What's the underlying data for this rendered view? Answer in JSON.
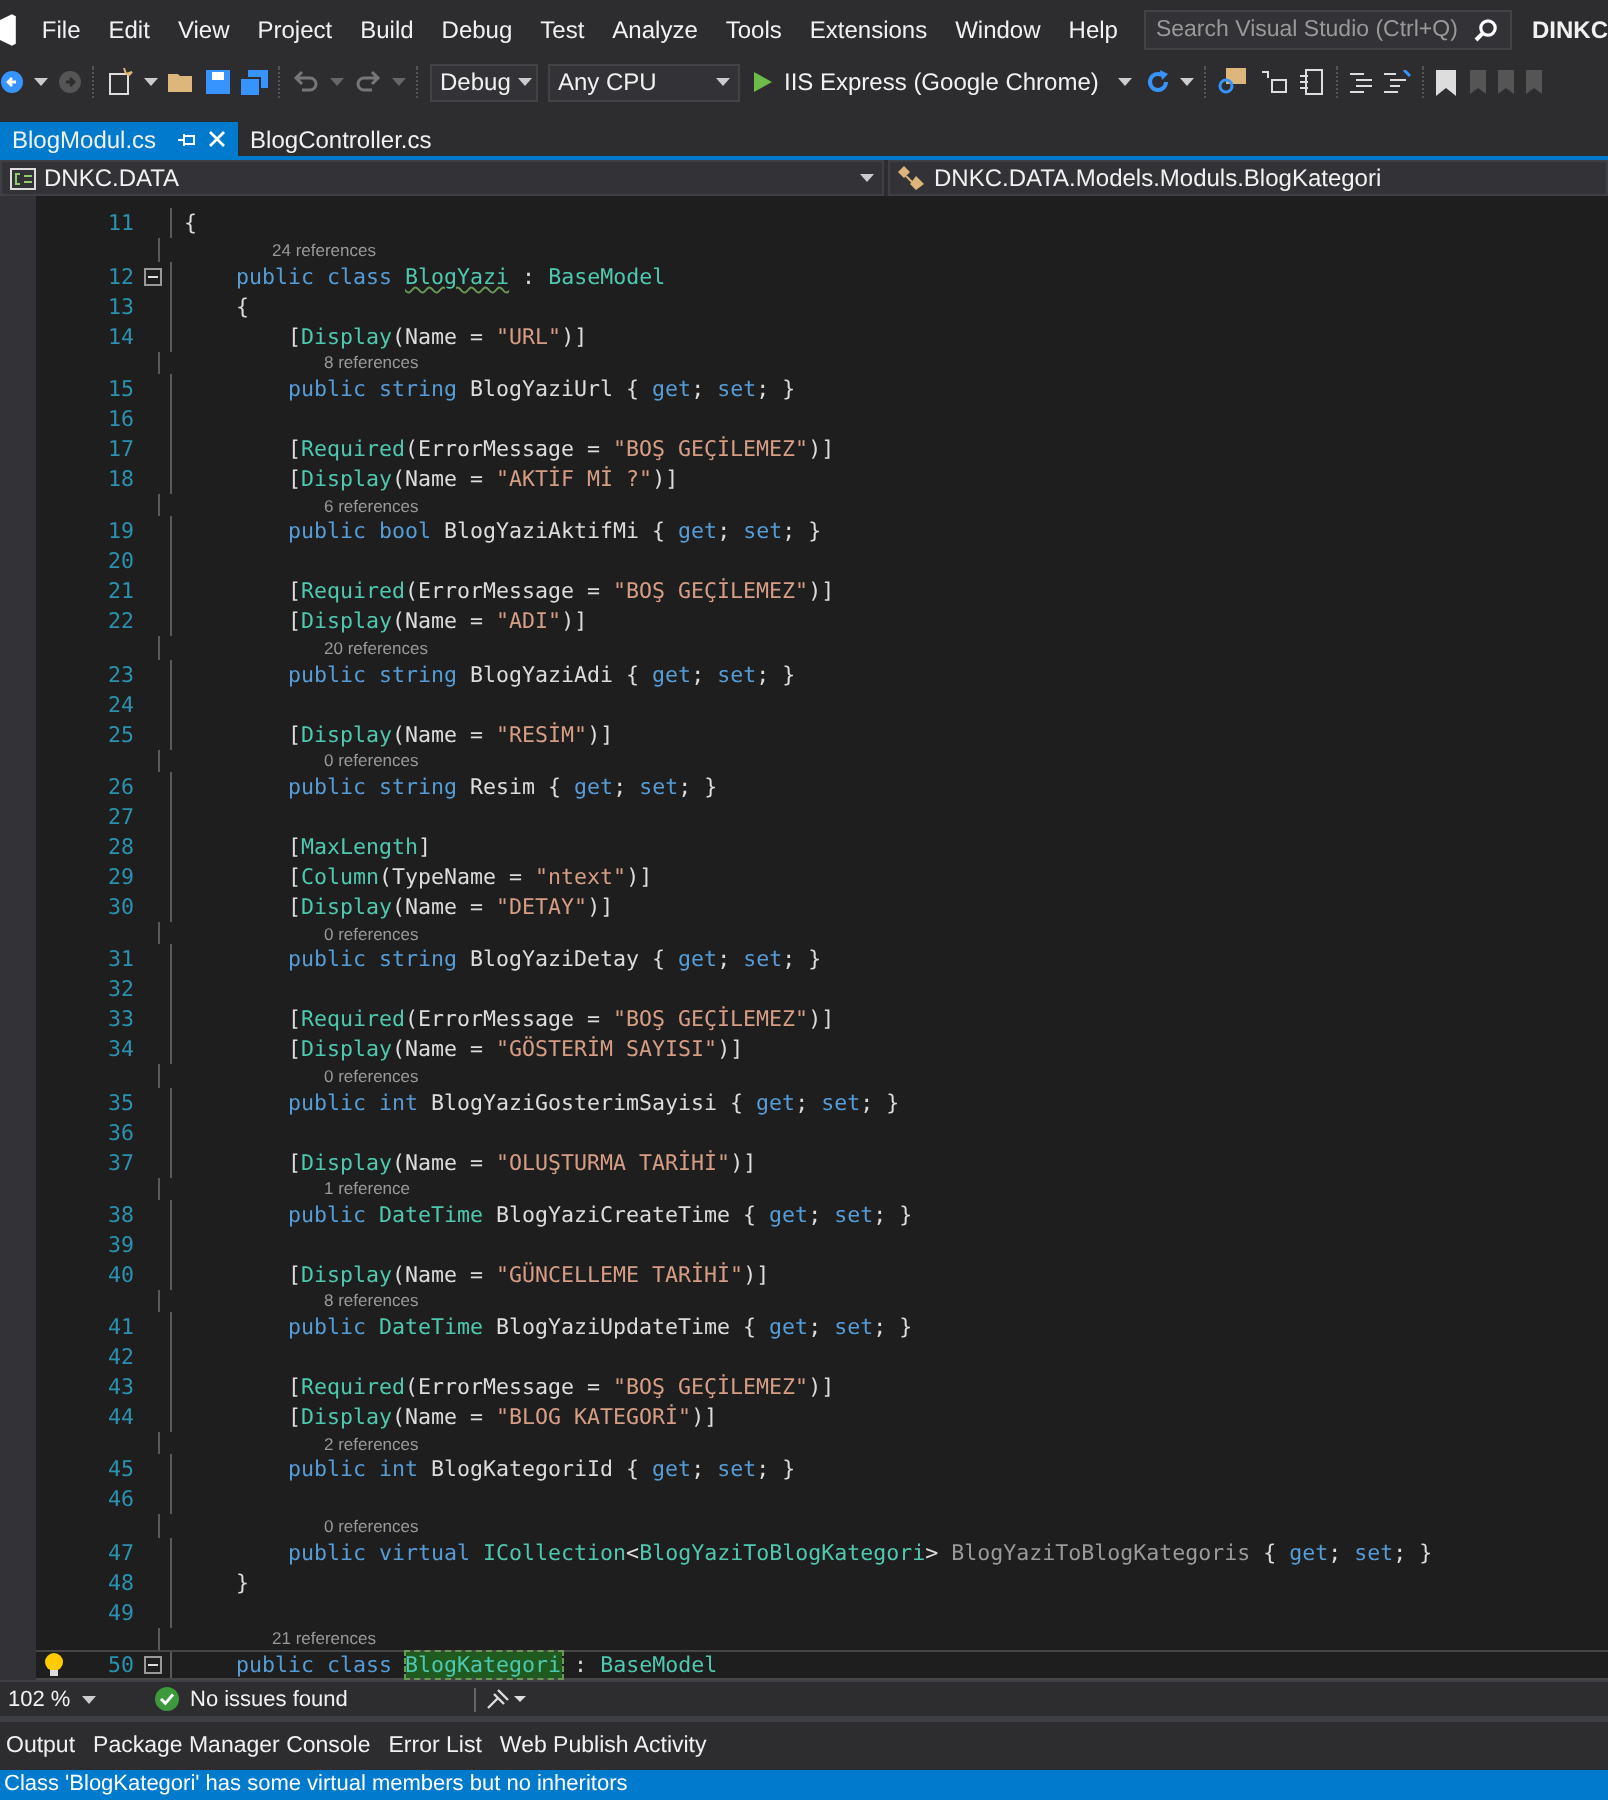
{
  "menu": [
    "File",
    "Edit",
    "View",
    "Project",
    "Build",
    "Debug",
    "Test",
    "Analyze",
    "Tools",
    "Extensions",
    "Window",
    "Help"
  ],
  "search": {
    "placeholder": "Search Visual Studio (Ctrl+Q)"
  },
  "account": "DINKC",
  "toolbar": {
    "configuration": "Debug",
    "platform": "Any CPU",
    "run": "IIS Express (Google Chrome)"
  },
  "tabs": [
    {
      "label": "BlogModul.cs",
      "selected": true
    },
    {
      "label": "BlogController.cs",
      "selected": false
    }
  ],
  "nav": {
    "project": "DNKC.DATA",
    "type": "DNKC.DATA.Models.Moduls.BlogKategori"
  },
  "lines": [
    {
      "kind": "code",
      "num": "11",
      "tokens": [
        {
          "kind": "plain",
          "text": "{"
        }
      ]
    },
    {
      "kind": "lens",
      "text": "24 references"
    },
    {
      "kind": "code",
      "num": "12",
      "outline": true,
      "tokens": [
        {
          "kind": "keyword",
          "text": "    public "
        },
        {
          "kind": "keyword",
          "text": "class "
        },
        {
          "kind": "squiggle",
          "text": "BlogYazi"
        },
        {
          "kind": "plain",
          "text": " : "
        },
        {
          "kind": "type",
          "text": "BaseModel"
        }
      ]
    },
    {
      "kind": "code",
      "num": "13",
      "tokens": [
        {
          "kind": "plain",
          "text": "    {"
        }
      ]
    },
    {
      "kind": "code",
      "num": "14",
      "tokens": [
        {
          "kind": "plain",
          "text": "        ["
        },
        {
          "kind": "type",
          "text": "Display"
        },
        {
          "kind": "plain",
          "text": "(Name = "
        },
        {
          "kind": "string",
          "text": "\"URL\""
        },
        {
          "kind": "plain",
          "text": ")]"
        }
      ]
    },
    {
      "kind": "lens",
      "text": "8 references"
    },
    {
      "kind": "code",
      "num": "15",
      "tokens": [
        {
          "kind": "keyword",
          "text": "        public "
        },
        {
          "kind": "keyword",
          "text": "string "
        },
        {
          "kind": "plain",
          "text": "BlogYaziUrl { "
        },
        {
          "kind": "keyword",
          "text": "get"
        },
        {
          "kind": "plain",
          "text": "; "
        },
        {
          "kind": "keyword",
          "text": "set"
        },
        {
          "kind": "plain",
          "text": "; }"
        }
      ]
    },
    {
      "kind": "code",
      "num": "16"
    },
    {
      "kind": "code",
      "num": "17",
      "tokens": [
        {
          "kind": "plain",
          "text": "        ["
        },
        {
          "kind": "type",
          "text": "Required"
        },
        {
          "kind": "plain",
          "text": "(ErrorMessage = "
        },
        {
          "kind": "string",
          "text": "\"BOŞ GEÇİLEMEZ\""
        },
        {
          "kind": "plain",
          "text": ")]"
        }
      ]
    },
    {
      "kind": "code",
      "num": "18",
      "tokens": [
        {
          "kind": "plain",
          "text": "        ["
        },
        {
          "kind": "type",
          "text": "Display"
        },
        {
          "kind": "plain",
          "text": "(Name = "
        },
        {
          "kind": "string",
          "text": "\"AKTİF Mİ ?\""
        },
        {
          "kind": "plain",
          "text": ")]"
        }
      ]
    },
    {
      "kind": "lens",
      "text": "6 references"
    },
    {
      "kind": "code",
      "num": "19",
      "tokens": [
        {
          "kind": "keyword",
          "text": "        public "
        },
        {
          "kind": "keyword",
          "text": "bool "
        },
        {
          "kind": "plain",
          "text": "BlogYaziAktifMi { "
        },
        {
          "kind": "keyword",
          "text": "get"
        },
        {
          "kind": "plain",
          "text": "; "
        },
        {
          "kind": "keyword",
          "text": "set"
        },
        {
          "kind": "plain",
          "text": "; }"
        }
      ]
    },
    {
      "kind": "code",
      "num": "20"
    },
    {
      "kind": "code",
      "num": "21",
      "tokens": [
        {
          "kind": "plain",
          "text": "        ["
        },
        {
          "kind": "type",
          "text": "Required"
        },
        {
          "kind": "plain",
          "text": "(ErrorMessage = "
        },
        {
          "kind": "string",
          "text": "\"BOŞ GEÇİLEMEZ\""
        },
        {
          "kind": "plain",
          "text": ")]"
        }
      ]
    },
    {
      "kind": "code",
      "num": "22",
      "tokens": [
        {
          "kind": "plain",
          "text": "        ["
        },
        {
          "kind": "type",
          "text": "Display"
        },
        {
          "kind": "plain",
          "text": "(Name = "
        },
        {
          "kind": "string",
          "text": "\"ADI\""
        },
        {
          "kind": "plain",
          "text": ")]"
        }
      ]
    },
    {
      "kind": "lens",
      "text": "20 references"
    },
    {
      "kind": "code",
      "num": "23",
      "tokens": [
        {
          "kind": "keyword",
          "text": "        public "
        },
        {
          "kind": "keyword",
          "text": "string "
        },
        {
          "kind": "plain",
          "text": "BlogYaziAdi { "
        },
        {
          "kind": "keyword",
          "text": "get"
        },
        {
          "kind": "plain",
          "text": "; "
        },
        {
          "kind": "keyword",
          "text": "set"
        },
        {
          "kind": "plain",
          "text": "; }"
        }
      ]
    },
    {
      "kind": "code",
      "num": "24"
    },
    {
      "kind": "code",
      "num": "25",
      "tokens": [
        {
          "kind": "plain",
          "text": "        ["
        },
        {
          "kind": "type",
          "text": "Display"
        },
        {
          "kind": "plain",
          "text": "(Name = "
        },
        {
          "kind": "string",
          "text": "\"RESİM\""
        },
        {
          "kind": "plain",
          "text": ")]"
        }
      ]
    },
    {
      "kind": "lens",
      "text": "0 references"
    },
    {
      "kind": "code",
      "num": "26",
      "tokens": [
        {
          "kind": "keyword",
          "text": "        public "
        },
        {
          "kind": "keyword",
          "text": "string "
        },
        {
          "kind": "plain",
          "text": "Resim { "
        },
        {
          "kind": "keyword",
          "text": "get"
        },
        {
          "kind": "plain",
          "text": "; "
        },
        {
          "kind": "keyword",
          "text": "set"
        },
        {
          "kind": "plain",
          "text": "; }"
        }
      ]
    },
    {
      "kind": "code",
      "num": "27"
    },
    {
      "kind": "code",
      "num": "28",
      "tokens": [
        {
          "kind": "plain",
          "text": "        ["
        },
        {
          "kind": "type",
          "text": "MaxLength"
        },
        {
          "kind": "plain",
          "text": "]"
        }
      ]
    },
    {
      "kind": "code",
      "num": "29",
      "tokens": [
        {
          "kind": "plain",
          "text": "        ["
        },
        {
          "kind": "type",
          "text": "Column"
        },
        {
          "kind": "plain",
          "text": "(TypeName = "
        },
        {
          "kind": "string",
          "text": "\"ntext\""
        },
        {
          "kind": "plain",
          "text": ")]"
        }
      ]
    },
    {
      "kind": "code",
      "num": "30",
      "tokens": [
        {
          "kind": "plain",
          "text": "        ["
        },
        {
          "kind": "type",
          "text": "Display"
        },
        {
          "kind": "plain",
          "text": "(Name = "
        },
        {
          "kind": "string",
          "text": "\"DETAY\""
        },
        {
          "kind": "plain",
          "text": ")]"
        }
      ]
    },
    {
      "kind": "lens",
      "text": "0 references"
    },
    {
      "kind": "code",
      "num": "31",
      "tokens": [
        {
          "kind": "keyword",
          "text": "        public "
        },
        {
          "kind": "keyword",
          "text": "string "
        },
        {
          "kind": "plain",
          "text": "BlogYaziDetay { "
        },
        {
          "kind": "keyword",
          "text": "get"
        },
        {
          "kind": "plain",
          "text": "; "
        },
        {
          "kind": "keyword",
          "text": "set"
        },
        {
          "kind": "plain",
          "text": "; }"
        }
      ]
    },
    {
      "kind": "code",
      "num": "32"
    },
    {
      "kind": "code",
      "num": "33",
      "tokens": [
        {
          "kind": "plain",
          "text": "        ["
        },
        {
          "kind": "type",
          "text": "Required"
        },
        {
          "kind": "plain",
          "text": "(ErrorMessage = "
        },
        {
          "kind": "string",
          "text": "\"BOŞ GEÇİLEMEZ\""
        },
        {
          "kind": "plain",
          "text": ")]"
        }
      ]
    },
    {
      "kind": "code",
      "num": "34",
      "tokens": [
        {
          "kind": "plain",
          "text": "        ["
        },
        {
          "kind": "type",
          "text": "Display"
        },
        {
          "kind": "plain",
          "text": "(Name = "
        },
        {
          "kind": "string",
          "text": "\"GÖSTERİM SAYISI\""
        },
        {
          "kind": "plain",
          "text": ")]"
        }
      ]
    },
    {
      "kind": "lens",
      "text": "0 references"
    },
    {
      "kind": "code",
      "num": "35",
      "tokens": [
        {
          "kind": "keyword",
          "text": "        public "
        },
        {
          "kind": "keyword",
          "text": "int "
        },
        {
          "kind": "plain",
          "text": "BlogYaziGosterimSayisi { "
        },
        {
          "kind": "keyword",
          "text": "get"
        },
        {
          "kind": "plain",
          "text": "; "
        },
        {
          "kind": "keyword",
          "text": "set"
        },
        {
          "kind": "plain",
          "text": "; }"
        }
      ]
    },
    {
      "kind": "code",
      "num": "36"
    },
    {
      "kind": "code",
      "num": "37",
      "tokens": [
        {
          "kind": "plain",
          "text": "        ["
        },
        {
          "kind": "type",
          "text": "Display"
        },
        {
          "kind": "plain",
          "text": "(Name = "
        },
        {
          "kind": "string",
          "text": "\"OLUŞTURMA TARİHİ\""
        },
        {
          "kind": "plain",
          "text": ")]"
        }
      ]
    },
    {
      "kind": "lens",
      "text": "1 reference"
    },
    {
      "kind": "code",
      "num": "38",
      "tokens": [
        {
          "kind": "keyword",
          "text": "        public "
        },
        {
          "kind": "type",
          "text": "DateTime"
        },
        {
          "kind": "plain",
          "text": " BlogYaziCreateTime { "
        },
        {
          "kind": "keyword",
          "text": "get"
        },
        {
          "kind": "plain",
          "text": "; "
        },
        {
          "kind": "keyword",
          "text": "set"
        },
        {
          "kind": "plain",
          "text": "; }"
        }
      ]
    },
    {
      "kind": "code",
      "num": "39"
    },
    {
      "kind": "code",
      "num": "40",
      "tokens": [
        {
          "kind": "plain",
          "text": "        ["
        },
        {
          "kind": "type",
          "text": "Display"
        },
        {
          "kind": "plain",
          "text": "(Name = "
        },
        {
          "kind": "string",
          "text": "\"GÜNCELLEME TARİHİ\""
        },
        {
          "kind": "plain",
          "text": ")]"
        }
      ]
    },
    {
      "kind": "lens",
      "text": "8 references"
    },
    {
      "kind": "code",
      "num": "41",
      "tokens": [
        {
          "kind": "keyword",
          "text": "        public "
        },
        {
          "kind": "type",
          "text": "DateTime"
        },
        {
          "kind": "plain",
          "text": " BlogYaziUpdateTime { "
        },
        {
          "kind": "keyword",
          "text": "get"
        },
        {
          "kind": "plain",
          "text": "; "
        },
        {
          "kind": "keyword",
          "text": "set"
        },
        {
          "kind": "plain",
          "text": "; }"
        }
      ]
    },
    {
      "kind": "code",
      "num": "42"
    },
    {
      "kind": "code",
      "num": "43",
      "tokens": [
        {
          "kind": "plain",
          "text": "        ["
        },
        {
          "kind": "type",
          "text": "Required"
        },
        {
          "kind": "plain",
          "text": "(ErrorMessage = "
        },
        {
          "kind": "string",
          "text": "\"BOŞ GEÇİLEMEZ\""
        },
        {
          "kind": "plain",
          "text": ")]"
        }
      ]
    },
    {
      "kind": "code",
      "num": "44",
      "tokens": [
        {
          "kind": "plain",
          "text": "        ["
        },
        {
          "kind": "type",
          "text": "Display"
        },
        {
          "kind": "plain",
          "text": "(Name = "
        },
        {
          "kind": "string",
          "text": "\"BLOG KATEGORİ\""
        },
        {
          "kind": "plain",
          "text": ")]"
        }
      ]
    },
    {
      "kind": "lens",
      "text": "2 references"
    },
    {
      "kind": "code",
      "num": "45",
      "tokens": [
        {
          "kind": "keyword",
          "text": "        public "
        },
        {
          "kind": "keyword",
          "text": "int "
        },
        {
          "kind": "plain",
          "text": "BlogKategoriId { "
        },
        {
          "kind": "keyword",
          "text": "get"
        },
        {
          "kind": "plain",
          "text": "; "
        },
        {
          "kind": "keyword",
          "text": "set"
        },
        {
          "kind": "plain",
          "text": "; }"
        }
      ]
    },
    {
      "kind": "code",
      "num": "46"
    },
    {
      "kind": "lens",
      "text": "0 references"
    },
    {
      "kind": "code",
      "num": "47",
      "tokens": [
        {
          "kind": "keyword",
          "text": "        public "
        },
        {
          "kind": "keyword",
          "text": "virtual "
        },
        {
          "kind": "type",
          "text": "ICollection"
        },
        {
          "kind": "plain",
          "text": "<"
        },
        {
          "kind": "type",
          "text": "BlogYaziToBlogKategori"
        },
        {
          "kind": "plain",
          "text": "> "
        },
        {
          "kind": "dim",
          "text": "BlogYaziToBlogKategoris"
        },
        {
          "kind": "plain",
          "text": " { "
        },
        {
          "kind": "keyword",
          "text": "get"
        },
        {
          "kind": "plain",
          "text": "; "
        },
        {
          "kind": "keyword",
          "text": "set"
        },
        {
          "kind": "plain",
          "text": "; }"
        }
      ]
    },
    {
      "kind": "code",
      "num": "48",
      "tokens": [
        {
          "kind": "plain",
          "text": "    }"
        }
      ]
    },
    {
      "kind": "code",
      "num": "49"
    },
    {
      "kind": "lens",
      "text": "21 references"
    },
    {
      "kind": "code",
      "num": "50",
      "outline": true,
      "current": true,
      "tokens": [
        {
          "kind": "keyword",
          "text": "    public "
        },
        {
          "kind": "keyword",
          "text": "class "
        },
        {
          "kind": "highlight",
          "text": "BlogKategori"
        },
        {
          "kind": "plain",
          "text": " : "
        },
        {
          "kind": "type",
          "text": "BaseModel"
        }
      ]
    }
  ],
  "editor_status": {
    "zoom": "102 %",
    "issues": "No issues found"
  },
  "panels": [
    "Output",
    "Package Manager Console",
    "Error List",
    "Web Publish Activity"
  ],
  "status_bar": "Class 'BlogKategori' has some virtual members but no inheritors"
}
